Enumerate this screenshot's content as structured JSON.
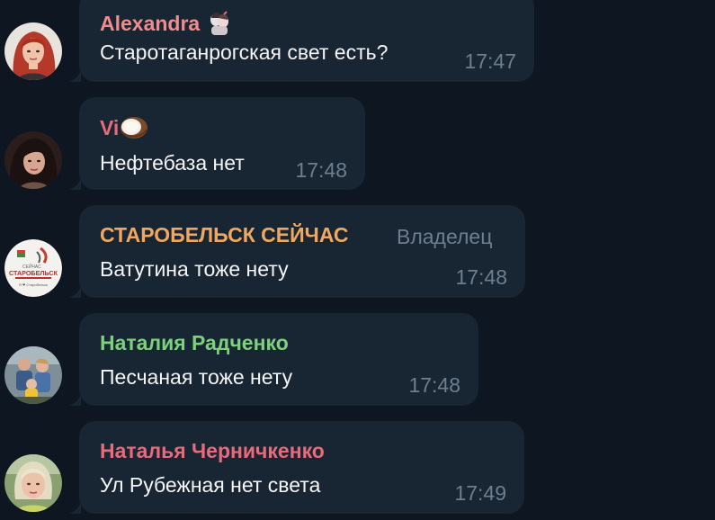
{
  "messages": [
    {
      "sender": "Alexandra",
      "sender_color": "#f08c8c",
      "text": "Старотаганрогская свет есть?",
      "time": "17:47",
      "avatar": "woman-red-hair-avatar",
      "sender_emoji": "couple-sticker-icon"
    },
    {
      "sender": "Vi",
      "sender_color": "#e96a7a",
      "text": "Нефтебаза нет",
      "time": "17:48",
      "avatar": "woman-dark-hair-avatar",
      "sender_emoji": "coconut-icon"
    },
    {
      "sender": "СТАРОБЕЛЬСК СЕЙЧАС",
      "sender_color": "#f0a861",
      "role": "Владелец",
      "text": "Ватутина тоже нету",
      "time": "17:48",
      "avatar": "starobelsk-logo-avatar",
      "logo_text_top": "СЕЙЧАС",
      "logo_text_main": "СТАРОБЕЛЬСК",
      "logo_text_bottom": "Я ❤ Старобельск"
    },
    {
      "sender": "Наталия Радченко",
      "sender_color": "#7cd17c",
      "text": "Песчаная тоже нету",
      "time": "17:48",
      "avatar": "family-photo-avatar"
    },
    {
      "sender": "Наталья Черничкенко",
      "sender_color": "#e96a7a",
      "text": "Ул Рубежная нет света",
      "time": "17:49",
      "avatar": "woman-blonde-avatar"
    }
  ]
}
